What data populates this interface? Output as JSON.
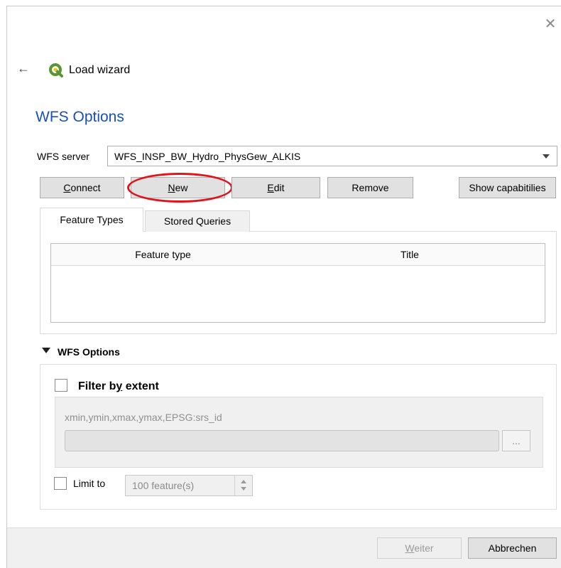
{
  "window": {
    "close_glyph": "✕",
    "back_glyph": "←",
    "title": "Load wizard",
    "logo_icon": "qgis-logo-icon"
  },
  "page": {
    "heading": "WFS Options"
  },
  "server": {
    "label": "WFS server",
    "selected": "WFS_INSP_BW_Hydro_PhysGew_ALKIS"
  },
  "buttons": {
    "connect": {
      "mnemonic": "C",
      "rest": "onnect"
    },
    "new": {
      "mnemonic": "N",
      "rest": "ew"
    },
    "edit": {
      "mnemonic": "E",
      "rest": "dit"
    },
    "remove": "Remove",
    "show_capabilities": "Show capabitilies"
  },
  "tabs": [
    {
      "label": "Feature Types",
      "active": true
    },
    {
      "label": "Stored Queries",
      "active": false
    }
  ],
  "table": {
    "columns": [
      "Feature type",
      "Title"
    ],
    "rows": []
  },
  "options": {
    "title": "WFS Options",
    "filter": {
      "before": "Filter b",
      "mnemonic": "y",
      "after": " extent",
      "checked": false
    },
    "extent_hint": "xmin,ymin,xmax,ymax,EPSG:srs_id",
    "extent_value": "",
    "extent_button": "...",
    "limit": {
      "label": "Limit to",
      "value": "100 feature(s)",
      "checked": false
    }
  },
  "footer": {
    "next": {
      "mnemonic": "W",
      "rest": "eiter"
    },
    "cancel": "Abbrechen"
  },
  "colors": {
    "heading": "#1a4fb8",
    "highlight": "#e0141b",
    "logo": "#589632"
  }
}
